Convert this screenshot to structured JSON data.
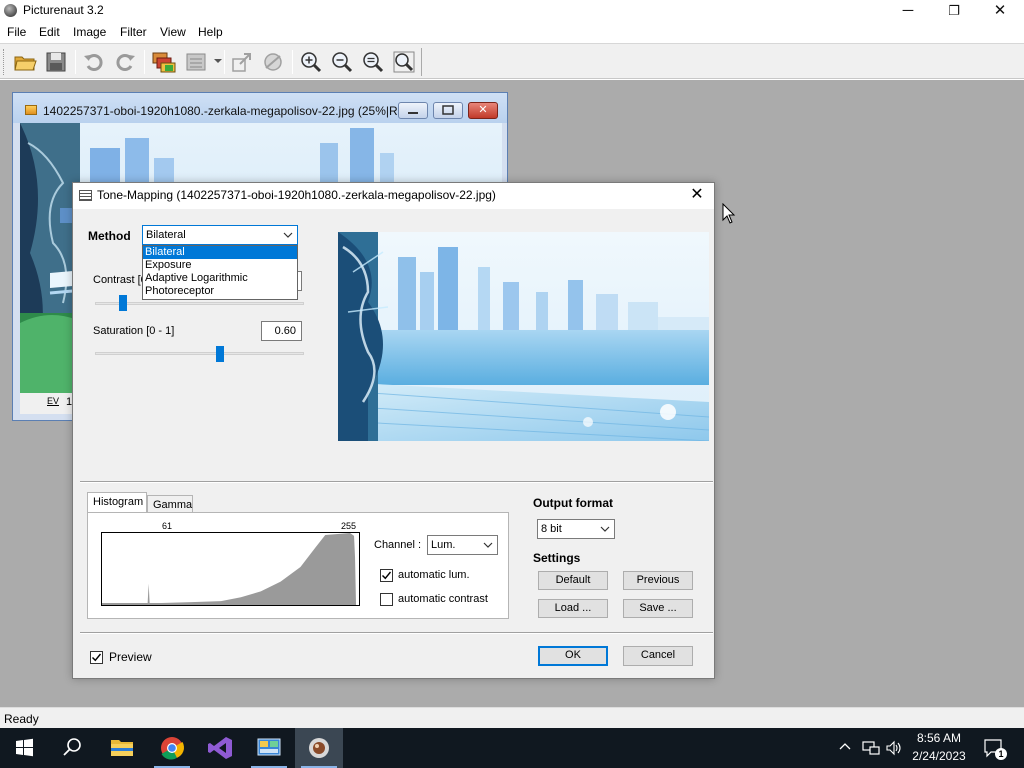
{
  "app": {
    "title": "Picturenaut 3.2"
  },
  "window_controls": {
    "minimize": "─",
    "maximize": "❐",
    "close": "✕"
  },
  "menu": [
    "File",
    "Edit",
    "Image",
    "Filter",
    "View",
    "Help"
  ],
  "toolbar": {
    "buttons": [
      "open-icon",
      "save-icon",
      "undo-icon",
      "redo-icon",
      "generate-hdr-icon",
      "batch-icon",
      "align-icon",
      "tone-map-icon",
      "zoom-in-icon",
      "zoom-out-icon",
      "zoom-fit-icon",
      "zoom-actual-icon"
    ]
  },
  "child_window": {
    "title": "1402257371-oboi-1920h1080.-zerkala-megapolisov-22.jpg (25%|R...",
    "ev_label": "EV",
    "ev_value": "1"
  },
  "dialog": {
    "title": "Tone-Mapping (1402257371-oboi-1920h1080.-zerkala-megapolisov-22.jpg)",
    "close": "✕",
    "method_label": "Method",
    "method_value": "Bilateral",
    "method_options": [
      "Bilateral",
      "Exposure",
      "Adaptive Logarithmic",
      "Photoreceptor"
    ],
    "method_selected_index": 0,
    "contrast_label": "Contrast [0 - 1]",
    "contrast_value": "",
    "contrast_level": 0.12,
    "saturation_label": "Saturation [0 - 1]",
    "saturation_value": "0.60",
    "saturation_level": 0.6,
    "tabs": [
      "Histogram",
      "Gamma"
    ],
    "active_tab": "Histogram",
    "histogram": {
      "min_label": "61",
      "max_label": "255"
    },
    "channel_label": "Channel :",
    "channel_value": "Lum.",
    "auto_lum_label": "automatic lum.",
    "auto_lum_checked": true,
    "auto_contrast_label": "automatic contrast",
    "auto_contrast_checked": false,
    "output_format_label": "Output format",
    "output_format_value": "8 bit",
    "settings_label": "Settings",
    "buttons": {
      "default": "Default",
      "previous": "Previous",
      "load": "Load ...",
      "save": "Save ...",
      "ok": "OK",
      "cancel": "Cancel"
    },
    "preview_label": "Preview",
    "preview_checked": true
  },
  "status": {
    "text": "Ready"
  },
  "taskbar": {
    "apps": [
      "start-icon",
      "search-icon",
      "file-explorer-icon",
      "chrome-icon",
      "visual-studio-icon",
      "control-panel-icon",
      "picturenaut-icon"
    ],
    "time": "8:56 AM",
    "date": "2/24/2023",
    "notification_count": "1"
  },
  "colors": {
    "accent": "#0078d7",
    "workspace": "#ababab",
    "taskbar": "#101820"
  }
}
